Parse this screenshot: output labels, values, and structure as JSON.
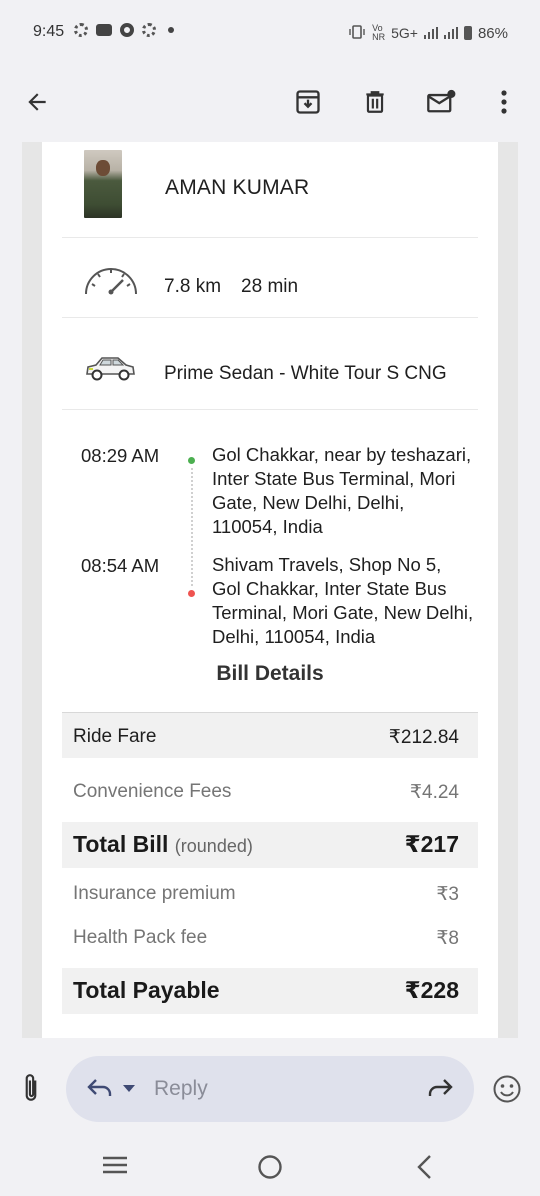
{
  "status_bar": {
    "time": "9:45",
    "network": "5G+",
    "battery": "86%"
  },
  "toolbar": {
    "icons": [
      "arrow-back-icon",
      "archive-icon",
      "delete-icon",
      "mark-unread-icon",
      "more-vert-icon"
    ]
  },
  "driver": {
    "name": "AMAN KUMAR"
  },
  "trip_summary": {
    "distance": "7.8 km",
    "duration": "28 min",
    "vehicle": "Prime Sedan - White Tour S CNG"
  },
  "trip": {
    "pickup": {
      "time": "08:29 AM",
      "address": "Gol Chakkar, near by teshazari, Inter State Bus Terminal, Mori Gate, New Delhi, Delhi, 110054, India"
    },
    "drop": {
      "time": "08:54 AM",
      "address": "Shivam Travels, Shop No 5, Gol Chakkar, Inter State Bus Terminal, Mori Gate, New Delhi, Delhi, 110054, India"
    }
  },
  "bill": {
    "title": "Bill Details",
    "ride_fare": {
      "label": "Ride Fare",
      "value": "₹212.84"
    },
    "convenience": {
      "label": "Convenience Fees",
      "value": "₹4.24"
    },
    "total_bill": {
      "label": "Total Bill",
      "sub": "(rounded)",
      "value": "₹217"
    },
    "insurance": {
      "label": "Insurance premium",
      "value": "₹3"
    },
    "health": {
      "label": "Health Pack fee",
      "value": "₹8"
    },
    "total_payable": {
      "label": "Total Payable",
      "value": "₹228"
    }
  },
  "reply_bar": {
    "placeholder": "Reply"
  },
  "colors": {
    "pickup_dot": "#4caf50",
    "drop_dot": "#ef5350",
    "reply_pill": "#dfe1ec",
    "background": "#f1f1f4"
  }
}
